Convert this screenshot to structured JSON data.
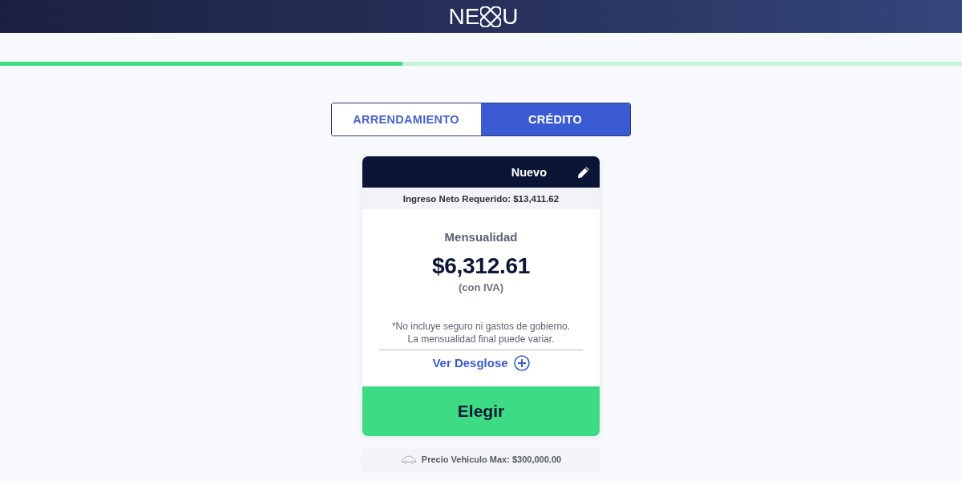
{
  "header": {
    "logo_left": "NE",
    "logo_right": "U"
  },
  "progress": {
    "level": 0.418
  },
  "tabs": [
    {
      "label": "ARRENDAMIENTO",
      "selected": false
    },
    {
      "label": "CRÉDITO",
      "selected": true
    }
  ],
  "card": {
    "title": "Nuevo",
    "income": "Ingreso Neto Requerido: $13,411.62",
    "payment_label": "Mensualidad",
    "payment": "$6,312.61",
    "tax_note": "(con IVA)",
    "disclaimer": [
      "*No incluye seguro ni gastos de gobierno.",
      "La mensualidad final puede variar."
    ],
    "breakdown_link": "Ver Desglose",
    "choose_button": "Elegir"
  },
  "footer_note": "Precio Vehiculo Max: $300,000.00"
}
